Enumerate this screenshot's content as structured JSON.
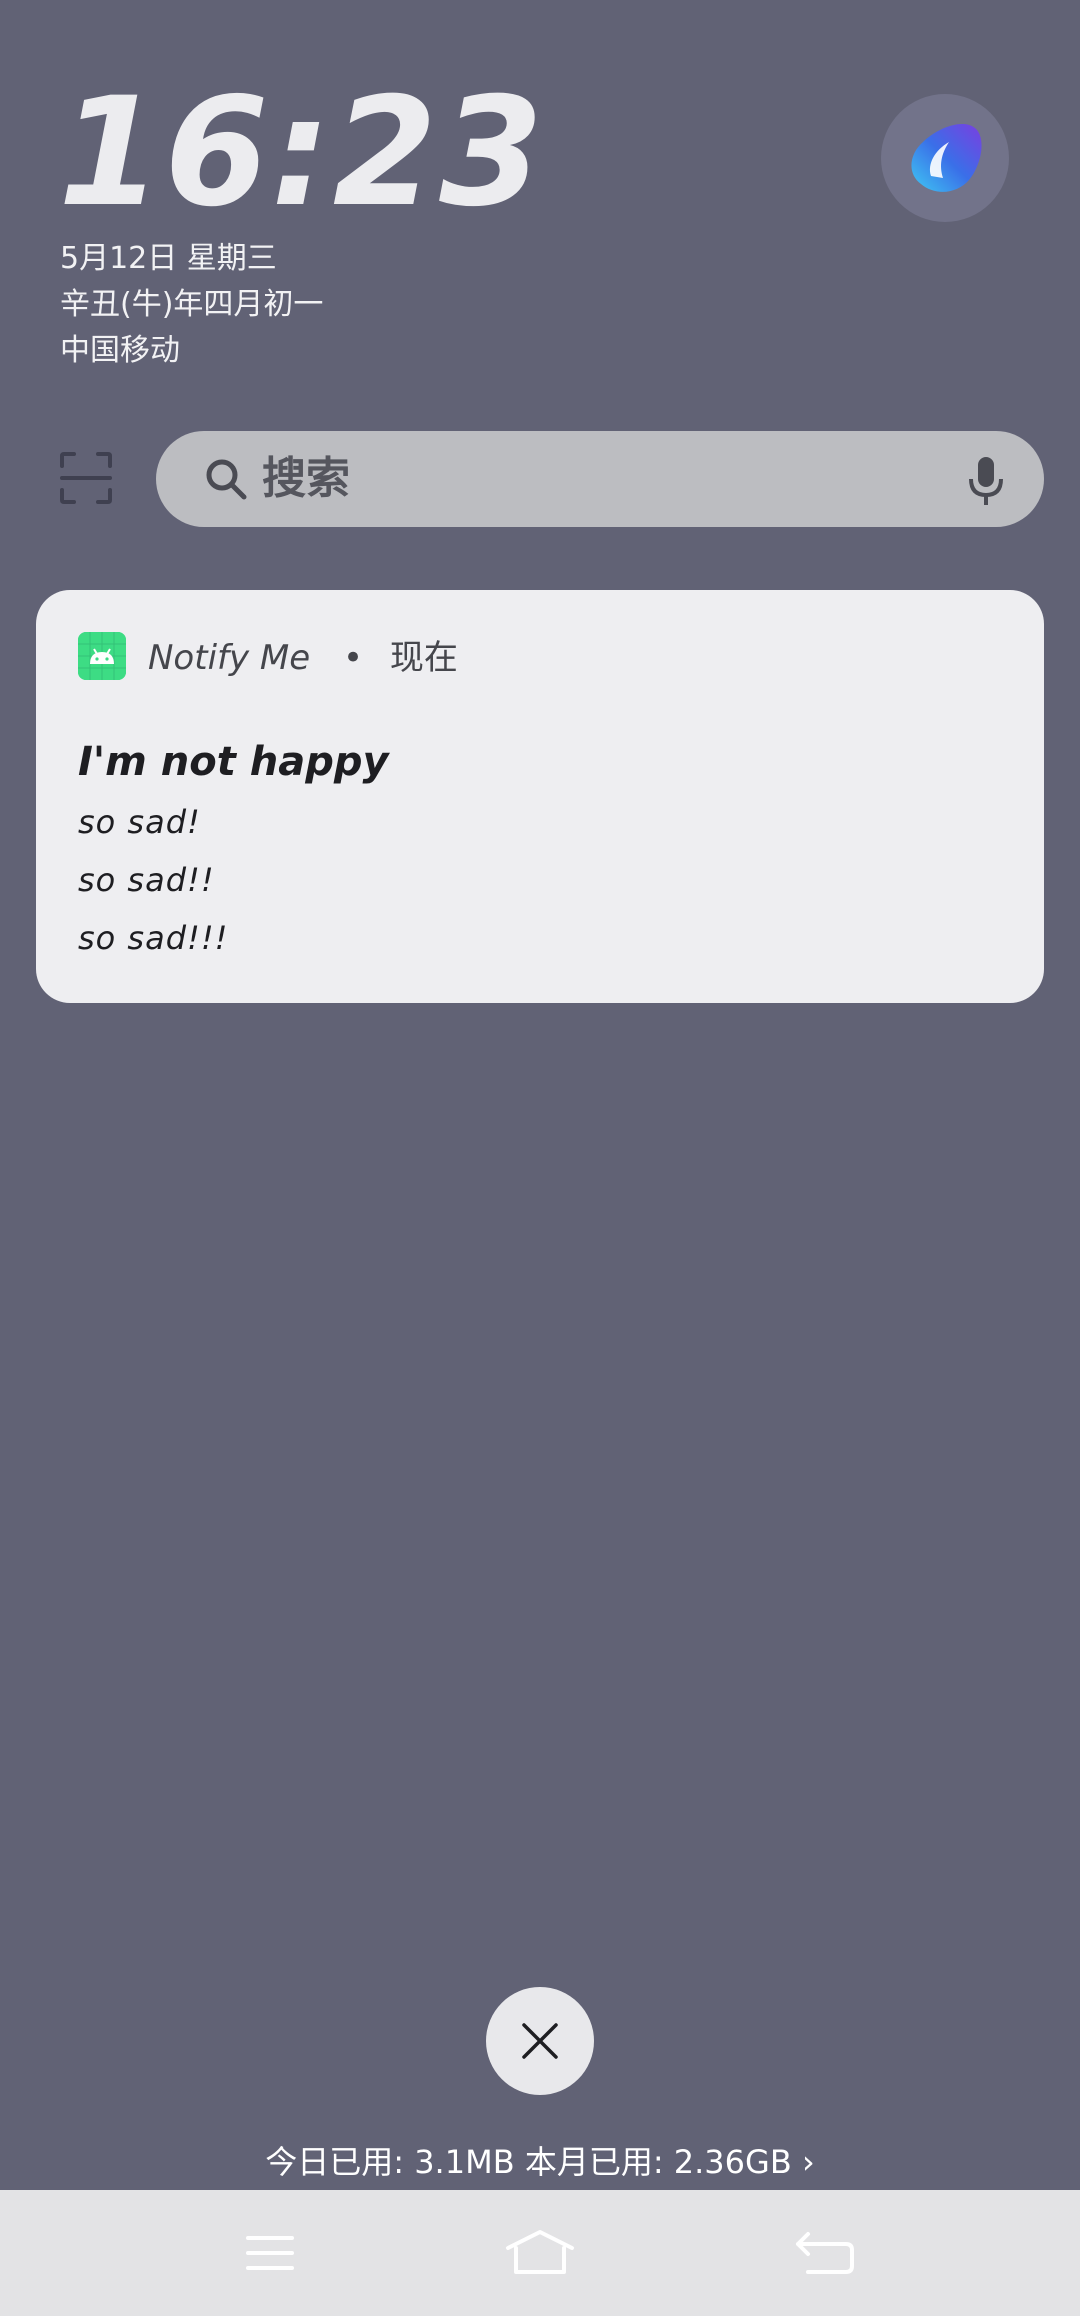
{
  "lockscreen": {
    "time": "16:23",
    "date": "5月12日 星期三",
    "lunar": "辛丑(牛)年四月初一",
    "carrier": "中国移动"
  },
  "search": {
    "placeholder": "搜索"
  },
  "notification": {
    "app_name": "Notify Me",
    "separator": "•",
    "time": "现在",
    "title": "I'm not happy",
    "lines": [
      "so sad!",
      "so sad!!",
      "so sad!!!"
    ]
  },
  "data_usage": {
    "text": "今日已用: 3.1MB 本月已用: 2.36GB ›"
  },
  "icons": {
    "avatar": "assistant-blob-icon",
    "scan": "scan-icon",
    "search": "search-icon",
    "mic": "mic-icon",
    "app": "android-icon",
    "close": "close-icon",
    "nav": [
      "menu-icon",
      "home-icon",
      "back-icon"
    ]
  },
  "colors": {
    "background": "#616275",
    "card": "#EEEEF1",
    "search_bar": "#BCBDC1",
    "app_icon": "#3DDC84"
  }
}
